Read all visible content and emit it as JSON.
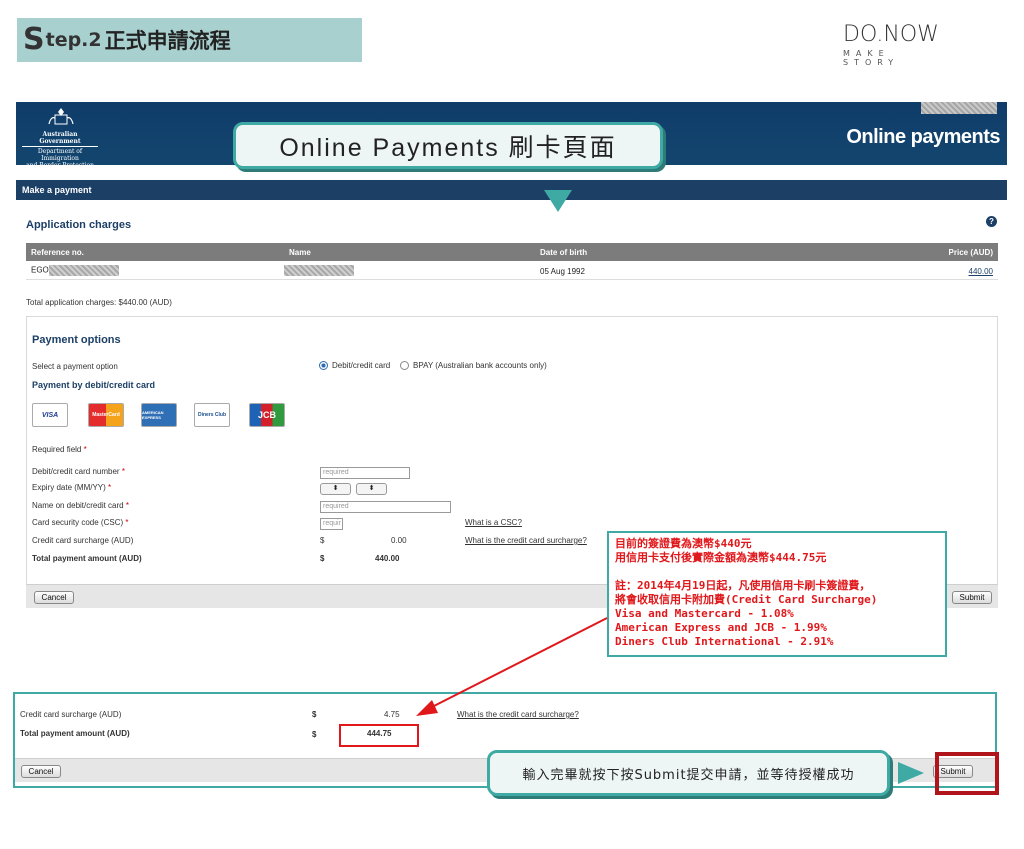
{
  "banner": {
    "step_s": "S",
    "step_rest": "tep.2",
    "step_title": "正式申請流程"
  },
  "brand": {
    "name": "DO.NOW",
    "tagline": "MAKE STORY"
  },
  "site": {
    "gov_line1": "Australian Government",
    "gov_line2": "Department of Immigration",
    "gov_line3": "and Border Protection",
    "title": "Online payments",
    "make_payment": "Make a payment",
    "application_charges": "Application charges",
    "help_glyph": "?",
    "table": {
      "headers": [
        "Reference no.",
        "Name",
        "Date of birth",
        "Price (AUD)"
      ],
      "row": {
        "reference_prefix": "EGO",
        "dob": "05 Aug 1992",
        "price": "440.00"
      }
    },
    "total_charges": "Total application charges: $440.00 (AUD)",
    "payment_options": "Payment options",
    "select_option_label": "Select a payment option",
    "option_card": "Debit/credit card",
    "option_bpay": "BPAY (Australian bank accounts only)",
    "payment_by_card": "Payment by debit/credit card",
    "cards": [
      "VISA",
      "MasterCard",
      "AMERICAN EXPRESS",
      "Diners Club",
      "JCB"
    ],
    "required_field": "Required field",
    "fields": {
      "card_number": "Debit/credit card number",
      "expiry": "Expiry date (MM/YY)",
      "name_on_card": "Name on debit/credit card",
      "csc": "Card security code (CSC)",
      "surcharge": "Credit card surcharge (AUD)",
      "total": "Total payment amount (AUD)"
    },
    "placeholder_required": "required",
    "placeholder_short": "requir",
    "select_glyph": "⬍",
    "what_is_csc": "What is a CSC?",
    "what_is_surcharge": "What is the credit card surcharge?",
    "currency": "$",
    "surcharge_value": "0.00",
    "total_value": "440.00",
    "cancel": "Cancel",
    "submit": "Submit"
  },
  "callout_top": "Online Payments 刷卡頁面",
  "note": {
    "line1": "目前的簽證費為澳幣$440元",
    "line2": "用信用卡支付後實際金額為澳幣$444.75元",
    "line3": "註：2014年4月19日起，凡使用信用卡刷卡簽證費，",
    "line4": "將會收取信用卡附加費(Credit Card Surcharge)",
    "line5": "Visa and Mastercard - 1.08%",
    "line6": "American Express and JCB - 1.99%",
    "line7": "Diners Club International - 2.91%"
  },
  "zoom": {
    "surcharge_label": "Credit card surcharge (AUD)",
    "total_label": "Total payment amount (AUD)",
    "currency": "$",
    "surcharge_value": "4.75",
    "total_value": "444.75",
    "surcharge_link": "What is the credit card surcharge?",
    "cancel": "Cancel",
    "submit": "Submit"
  },
  "callout_bottom": "輸入完畢就按下按Submit提交申請，並等待授權成功",
  "colors": {
    "navy": "#1c3f66",
    "teal": "#3fa9a4",
    "red": "#e0181b"
  }
}
